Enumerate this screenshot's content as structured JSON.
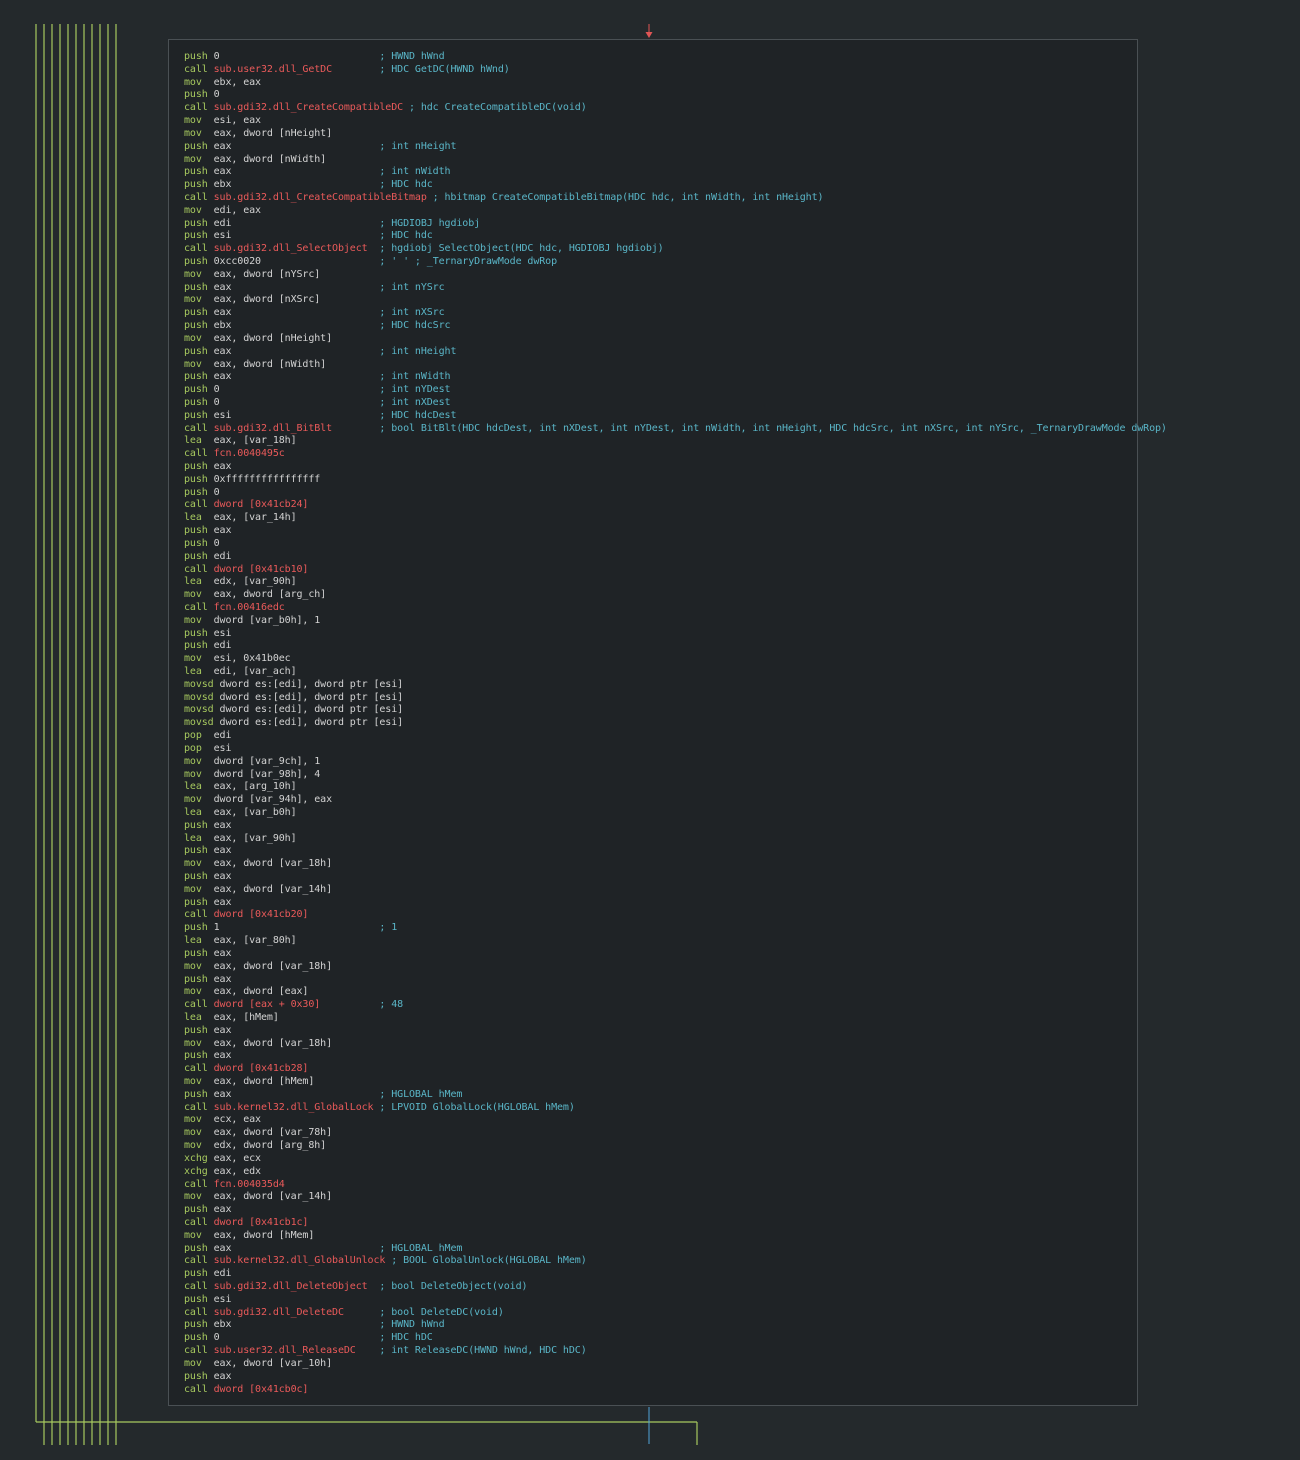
{
  "colors": {
    "background": "#24292c",
    "node_background": "#1f2326",
    "node_border": "#4a5054",
    "mnemonic": "#a7c95f",
    "call_target": "#ea5a5a",
    "operand": "#d3d3d3",
    "comment": "#5ab6c8",
    "edge_green": "#a7c95f",
    "edge_blue": "#4fa3d9",
    "arrow_red": "#e05555"
  },
  "icons": {
    "entry_arrow": "down-arrow-icon"
  },
  "asm": [
    {
      "mnemonic": "push",
      "operand": "0",
      "comment": "HWND hWnd"
    },
    {
      "mnemonic": "call",
      "operand": "sub.user32.dll_GetDC",
      "comment": "HDC GetDC(HWND hWnd)"
    },
    {
      "mnemonic": "mov",
      "operand": "ebx, eax",
      "comment": ""
    },
    {
      "mnemonic": "push",
      "operand": "0",
      "comment": ""
    },
    {
      "mnemonic": "call",
      "operand": "sub.gdi32.dll_CreateCompatibleDC",
      "comment": "hdc CreateCompatibleDC(void)"
    },
    {
      "mnemonic": "mov",
      "operand": "esi, eax",
      "comment": ""
    },
    {
      "mnemonic": "mov",
      "operand": "eax, dword [nHeight]",
      "comment": ""
    },
    {
      "mnemonic": "push",
      "operand": "eax",
      "comment": "int nHeight"
    },
    {
      "mnemonic": "mov",
      "operand": "eax, dword [nWidth]",
      "comment": ""
    },
    {
      "mnemonic": "push",
      "operand": "eax",
      "comment": "int nWidth"
    },
    {
      "mnemonic": "push",
      "operand": "ebx",
      "comment": "HDC hdc"
    },
    {
      "mnemonic": "call",
      "operand": "sub.gdi32.dll_CreateCompatibleBitmap",
      "comment": "hbitmap CreateCompatibleBitmap(HDC hdc, int nWidth, int nHeight)"
    },
    {
      "mnemonic": "mov",
      "operand": "edi, eax",
      "comment": ""
    },
    {
      "mnemonic": "push",
      "operand": "edi",
      "comment": "HGDIOBJ hgdiobj"
    },
    {
      "mnemonic": "push",
      "operand": "esi",
      "comment": "HDC hdc"
    },
    {
      "mnemonic": "call",
      "operand": "sub.gdi32.dll_SelectObject",
      "comment": "hgdiobj SelectObject(HDC hdc, HGDIOBJ hgdiobj)"
    },
    {
      "mnemonic": "push",
      "operand": "0xcc0020",
      "comment": "' ' ; _TernaryDrawMode dwRop"
    },
    {
      "mnemonic": "mov",
      "operand": "eax, dword [nYSrc]",
      "comment": ""
    },
    {
      "mnemonic": "push",
      "operand": "eax",
      "comment": "int nYSrc"
    },
    {
      "mnemonic": "mov",
      "operand": "eax, dword [nXSrc]",
      "comment": ""
    },
    {
      "mnemonic": "push",
      "operand": "eax",
      "comment": "int nXSrc"
    },
    {
      "mnemonic": "push",
      "operand": "ebx",
      "comment": "HDC hdcSrc"
    },
    {
      "mnemonic": "mov",
      "operand": "eax, dword [nHeight]",
      "comment": ""
    },
    {
      "mnemonic": "push",
      "operand": "eax",
      "comment": "int nHeight"
    },
    {
      "mnemonic": "mov",
      "operand": "eax, dword [nWidth]",
      "comment": ""
    },
    {
      "mnemonic": "push",
      "operand": "eax",
      "comment": "int nWidth"
    },
    {
      "mnemonic": "push",
      "operand": "0",
      "comment": "int nYDest"
    },
    {
      "mnemonic": "push",
      "operand": "0",
      "comment": "int nXDest"
    },
    {
      "mnemonic": "push",
      "operand": "esi",
      "comment": "HDC hdcDest"
    },
    {
      "mnemonic": "call",
      "operand": "sub.gdi32.dll_BitBlt",
      "comment": "bool BitBlt(HDC hdcDest, int nXDest, int nYDest, int nWidth, int nHeight, HDC hdcSrc, int nXSrc, int nYSrc, _TernaryDrawMode dwRop)"
    },
    {
      "mnemonic": "lea",
      "operand": "eax, [var_18h]",
      "comment": ""
    },
    {
      "mnemonic": "call",
      "operand": "fcn.0040495c",
      "comment": ""
    },
    {
      "mnemonic": "push",
      "operand": "eax",
      "comment": ""
    },
    {
      "mnemonic": "push",
      "operand": "0xffffffffffffffff",
      "comment": ""
    },
    {
      "mnemonic": "push",
      "operand": "0",
      "comment": ""
    },
    {
      "mnemonic": "call",
      "operand": "dword [0x41cb24]",
      "comment": ""
    },
    {
      "mnemonic": "lea",
      "operand": "eax, [var_14h]",
      "comment": ""
    },
    {
      "mnemonic": "push",
      "operand": "eax",
      "comment": ""
    },
    {
      "mnemonic": "push",
      "operand": "0",
      "comment": ""
    },
    {
      "mnemonic": "push",
      "operand": "edi",
      "comment": ""
    },
    {
      "mnemonic": "call",
      "operand": "dword [0x41cb10]",
      "comment": ""
    },
    {
      "mnemonic": "lea",
      "operand": "edx, [var_90h]",
      "comment": ""
    },
    {
      "mnemonic": "mov",
      "operand": "eax, dword [arg_ch]",
      "comment": ""
    },
    {
      "mnemonic": "call",
      "operand": "fcn.00416edc",
      "comment": ""
    },
    {
      "mnemonic": "mov",
      "operand": "dword [var_b0h], 1",
      "comment": ""
    },
    {
      "mnemonic": "push",
      "operand": "esi",
      "comment": ""
    },
    {
      "mnemonic": "push",
      "operand": "edi",
      "comment": ""
    },
    {
      "mnemonic": "mov",
      "operand": "esi, 0x41b0ec",
      "comment": ""
    },
    {
      "mnemonic": "lea",
      "operand": "edi, [var_ach]",
      "comment": ""
    },
    {
      "mnemonic": "movsd",
      "operand": "dword es:[edi], dword ptr [esi]",
      "comment": ""
    },
    {
      "mnemonic": "movsd",
      "operand": "dword es:[edi], dword ptr [esi]",
      "comment": ""
    },
    {
      "mnemonic": "movsd",
      "operand": "dword es:[edi], dword ptr [esi]",
      "comment": ""
    },
    {
      "mnemonic": "movsd",
      "operand": "dword es:[edi], dword ptr [esi]",
      "comment": ""
    },
    {
      "mnemonic": "pop",
      "operand": "edi",
      "comment": ""
    },
    {
      "mnemonic": "pop",
      "operand": "esi",
      "comment": ""
    },
    {
      "mnemonic": "mov",
      "operand": "dword [var_9ch], 1",
      "comment": ""
    },
    {
      "mnemonic": "mov",
      "operand": "dword [var_98h], 4",
      "comment": ""
    },
    {
      "mnemonic": "lea",
      "operand": "eax, [arg_10h]",
      "comment": ""
    },
    {
      "mnemonic": "mov",
      "operand": "dword [var_94h], eax",
      "comment": ""
    },
    {
      "mnemonic": "lea",
      "operand": "eax, [var_b0h]",
      "comment": ""
    },
    {
      "mnemonic": "push",
      "operand": "eax",
      "comment": ""
    },
    {
      "mnemonic": "lea",
      "operand": "eax, [var_90h]",
      "comment": ""
    },
    {
      "mnemonic": "push",
      "operand": "eax",
      "comment": ""
    },
    {
      "mnemonic": "mov",
      "operand": "eax, dword [var_18h]",
      "comment": ""
    },
    {
      "mnemonic": "push",
      "operand": "eax",
      "comment": ""
    },
    {
      "mnemonic": "mov",
      "operand": "eax, dword [var_14h]",
      "comment": ""
    },
    {
      "mnemonic": "push",
      "operand": "eax",
      "comment": ""
    },
    {
      "mnemonic": "call",
      "operand": "dword [0x41cb20]",
      "comment": ""
    },
    {
      "mnemonic": "push",
      "operand": "1",
      "comment": "1"
    },
    {
      "mnemonic": "lea",
      "operand": "eax, [var_80h]",
      "comment": ""
    },
    {
      "mnemonic": "push",
      "operand": "eax",
      "comment": ""
    },
    {
      "mnemonic": "mov",
      "operand": "eax, dword [var_18h]",
      "comment": ""
    },
    {
      "mnemonic": "push",
      "operand": "eax",
      "comment": ""
    },
    {
      "mnemonic": "mov",
      "operand": "eax, dword [eax]",
      "comment": ""
    },
    {
      "mnemonic": "call",
      "operand": "dword [eax + 0x30]",
      "comment": "48"
    },
    {
      "mnemonic": "lea",
      "operand": "eax, [hMem]",
      "comment": ""
    },
    {
      "mnemonic": "push",
      "operand": "eax",
      "comment": ""
    },
    {
      "mnemonic": "mov",
      "operand": "eax, dword [var_18h]",
      "comment": ""
    },
    {
      "mnemonic": "push",
      "operand": "eax",
      "comment": ""
    },
    {
      "mnemonic": "call",
      "operand": "dword [0x41cb28]",
      "comment": ""
    },
    {
      "mnemonic": "mov",
      "operand": "eax, dword [hMem]",
      "comment": ""
    },
    {
      "mnemonic": "push",
      "operand": "eax",
      "comment": "HGLOBAL hMem"
    },
    {
      "mnemonic": "call",
      "operand": "sub.kernel32.dll_GlobalLock",
      "comment": "LPVOID GlobalLock(HGLOBAL hMem)"
    },
    {
      "mnemonic": "mov",
      "operand": "ecx, eax",
      "comment": ""
    },
    {
      "mnemonic": "mov",
      "operand": "eax, dword [var_78h]",
      "comment": ""
    },
    {
      "mnemonic": "mov",
      "operand": "edx, dword [arg_8h]",
      "comment": ""
    },
    {
      "mnemonic": "xchg",
      "operand": "eax, ecx",
      "comment": ""
    },
    {
      "mnemonic": "xchg",
      "operand": "eax, edx",
      "comment": ""
    },
    {
      "mnemonic": "call",
      "operand": "fcn.004035d4",
      "comment": ""
    },
    {
      "mnemonic": "mov",
      "operand": "eax, dword [var_14h]",
      "comment": ""
    },
    {
      "mnemonic": "push",
      "operand": "eax",
      "comment": ""
    },
    {
      "mnemonic": "call",
      "operand": "dword [0x41cb1c]",
      "comment": ""
    },
    {
      "mnemonic": "mov",
      "operand": "eax, dword [hMem]",
      "comment": ""
    },
    {
      "mnemonic": "push",
      "operand": "eax",
      "comment": "HGLOBAL hMem"
    },
    {
      "mnemonic": "call",
      "operand": "sub.kernel32.dll_GlobalUnlock",
      "comment": "BOOL GlobalUnlock(HGLOBAL hMem)"
    },
    {
      "mnemonic": "push",
      "operand": "edi",
      "comment": ""
    },
    {
      "mnemonic": "call",
      "operand": "sub.gdi32.dll_DeleteObject",
      "comment": "bool DeleteObject(void)"
    },
    {
      "mnemonic": "push",
      "operand": "esi",
      "comment": ""
    },
    {
      "mnemonic": "call",
      "operand": "sub.gdi32.dll_DeleteDC",
      "comment": "bool DeleteDC(void)"
    },
    {
      "mnemonic": "push",
      "operand": "ebx",
      "comment": "HWND hWnd"
    },
    {
      "mnemonic": "push",
      "operand": "0",
      "comment": "HDC hDC"
    },
    {
      "mnemonic": "call",
      "operand": "sub.user32.dll_ReleaseDC",
      "comment": "int ReleaseDC(HWND hWnd, HDC hDC)"
    },
    {
      "mnemonic": "mov",
      "operand": "eax, dword [var_10h]",
      "comment": ""
    },
    {
      "mnemonic": "push",
      "operand": "eax",
      "comment": ""
    },
    {
      "mnemonic": "call",
      "operand": "dword [0x41cb0c]",
      "comment": ""
    }
  ]
}
